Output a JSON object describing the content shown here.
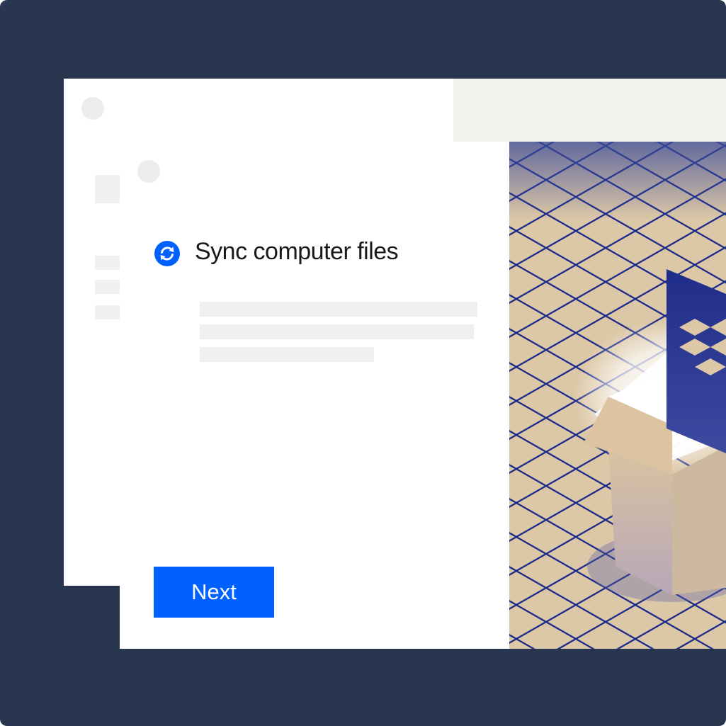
{
  "dialog": {
    "title": "Sync computer files",
    "next_label": "Next"
  },
  "icons": {
    "title_icon": "sync-icon",
    "illustration": "open-box-with-dropbox-logo"
  },
  "colors": {
    "background": "#28364f",
    "primary_button": "#0061fe",
    "illustration_tan": "#dcc7a6",
    "illustration_blue": "#1f2d8a"
  }
}
